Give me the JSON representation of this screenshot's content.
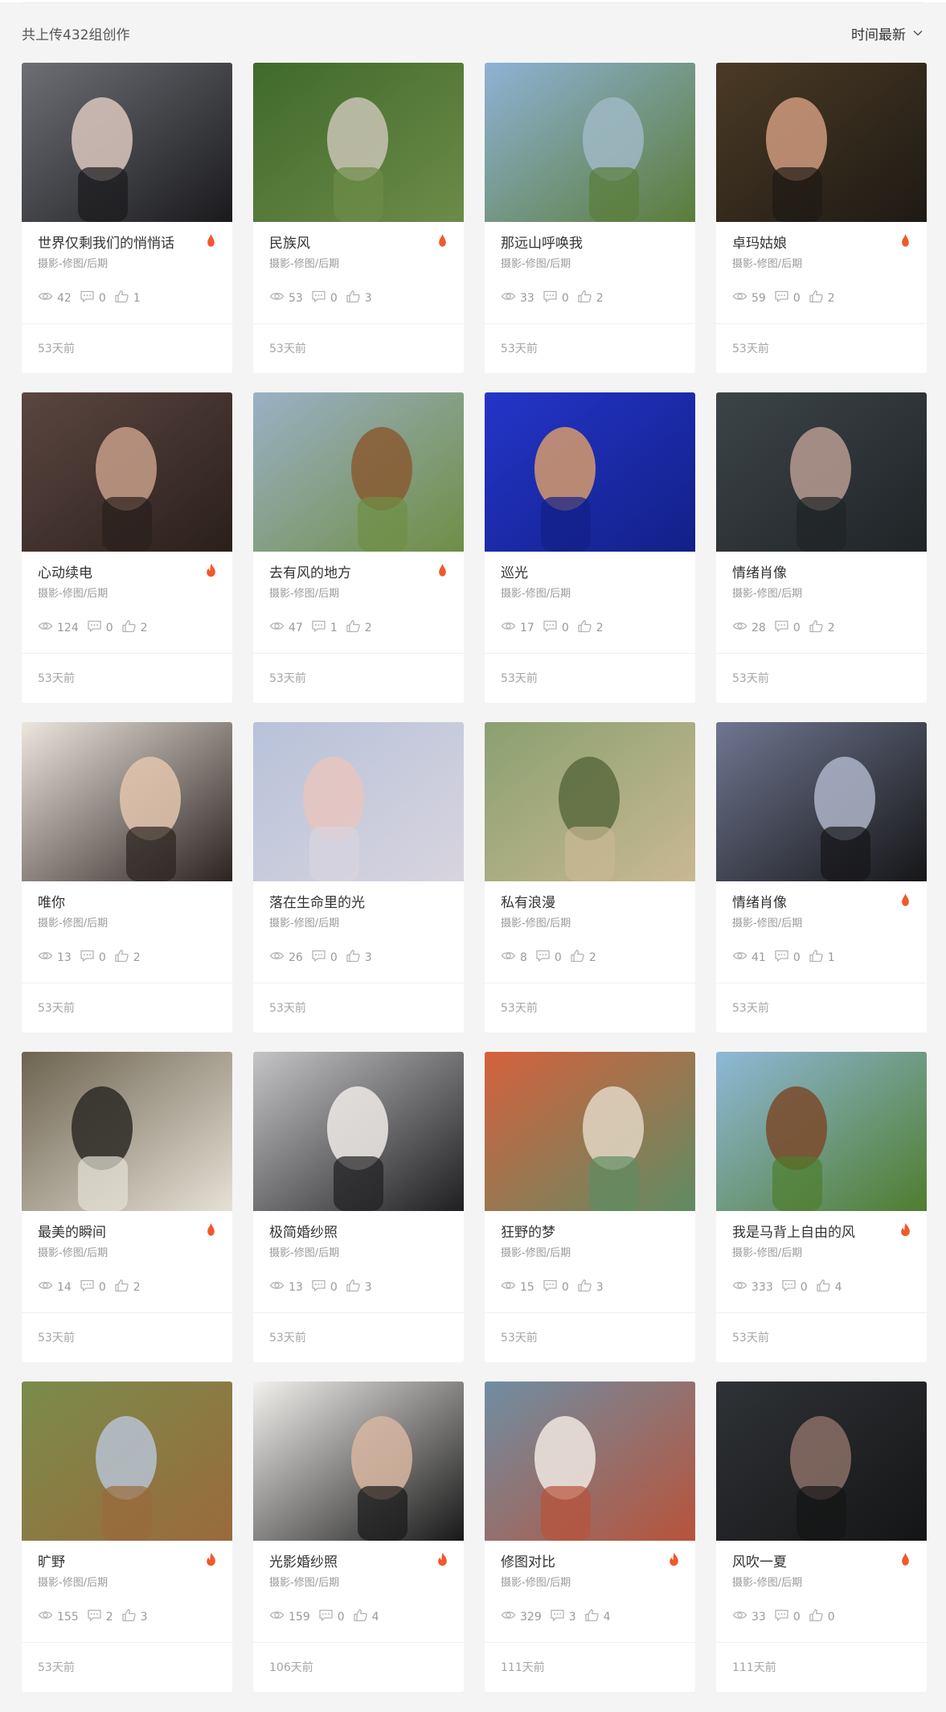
{
  "header": {
    "total_text": "共上传432组创作",
    "sort_label": "时间最新"
  },
  "colors": {
    "hot_icon": "#f1582a",
    "meta_text": "#9a9a9a",
    "title_text": "#333333"
  },
  "works": [
    {
      "title": "世界仅剩我们的悄悄话",
      "category": "摄影-修图/后期",
      "views": "42",
      "comments": "0",
      "likes": "1",
      "date": "53天前",
      "hot": "drop",
      "palette": [
        "#6d6f75",
        "#1a1a1d",
        "#d9c7bd"
      ]
    },
    {
      "title": "民族风",
      "category": "摄影-修图/后期",
      "views": "53",
      "comments": "0",
      "likes": "3",
      "date": "53天前",
      "hot": "drop",
      "palette": [
        "#3f6a2b",
        "#6d8b49",
        "#c9c3b5"
      ]
    },
    {
      "title": "那远山呼唤我",
      "category": "摄影-修图/后期",
      "views": "33",
      "comments": "0",
      "likes": "2",
      "date": "53天前",
      "hot": "none",
      "palette": [
        "#8fb2d6",
        "#5a7d3a",
        "#9fb9c4"
      ]
    },
    {
      "title": "卓玛姑娘",
      "category": "摄影-修图/后期",
      "views": "59",
      "comments": "0",
      "likes": "2",
      "date": "53天前",
      "hot": "drop",
      "palette": [
        "#4b3a25",
        "#1e1a14",
        "#cf9a7e"
      ]
    },
    {
      "title": "心动续电",
      "category": "摄影-修图/后期",
      "views": "124",
      "comments": "0",
      "likes": "2",
      "date": "53天前",
      "hot": "flame",
      "palette": [
        "#5b4640",
        "#2a1f1c",
        "#c79d88"
      ]
    },
    {
      "title": "去有风的地方",
      "category": "摄影-修图/后期",
      "views": "47",
      "comments": "1",
      "likes": "2",
      "date": "53天前",
      "hot": "drop",
      "palette": [
        "#9bb0c6",
        "#6f8e45",
        "#8a5a32"
      ]
    },
    {
      "title": "巡光",
      "category": "摄影-修图/后期",
      "views": "17",
      "comments": "0",
      "likes": "2",
      "date": "53天前",
      "hot": "none",
      "palette": [
        "#2435c9",
        "#122087",
        "#d59a6c"
      ]
    },
    {
      "title": "情绪肖像",
      "category": "摄影-修图/后期",
      "views": "28",
      "comments": "0",
      "likes": "2",
      "date": "53天前",
      "hot": "none",
      "palette": [
        "#3d4448",
        "#1f2427",
        "#b79b90"
      ]
    },
    {
      "title": "唯你",
      "category": "摄影-修图/后期",
      "views": "13",
      "comments": "0",
      "likes": "2",
      "date": "53天前",
      "hot": "none",
      "palette": [
        "#ede6df",
        "#2b2320",
        "#e3c5ae"
      ]
    },
    {
      "title": "落在生命里的光",
      "category": "摄影-修图/后期",
      "views": "26",
      "comments": "0",
      "likes": "3",
      "date": "53天前",
      "hot": "none",
      "palette": [
        "#b7c2d9",
        "#d8d4df",
        "#e8c5c0"
      ]
    },
    {
      "title": "私有浪漫",
      "category": "摄影-修图/后期",
      "views": "8",
      "comments": "0",
      "likes": "2",
      "date": "53天前",
      "hot": "none",
      "palette": [
        "#8aa070",
        "#c9b893",
        "#5b6a3e"
      ]
    },
    {
      "title": "情绪肖像",
      "category": "摄影-修图/后期",
      "views": "41",
      "comments": "0",
      "likes": "1",
      "date": "53天前",
      "hot": "drop",
      "palette": [
        "#6f7690",
        "#161618",
        "#aeb4c8"
      ]
    },
    {
      "title": "最美的瞬间",
      "category": "摄影-修图/后期",
      "views": "14",
      "comments": "0",
      "likes": "2",
      "date": "53天前",
      "hot": "drop",
      "palette": [
        "#6d6350",
        "#e6e1d6",
        "#2c2a25"
      ]
    },
    {
      "title": "极简婚纱照",
      "category": "摄影-修图/后期",
      "views": "13",
      "comments": "0",
      "likes": "3",
      "date": "53天前",
      "hot": "none",
      "palette": [
        "#c5c4c7",
        "#1f1e21",
        "#efeae6"
      ]
    },
    {
      "title": "狂野的梦",
      "category": "摄影-修图/后期",
      "views": "15",
      "comments": "0",
      "likes": "3",
      "date": "53天前",
      "hot": "none",
      "palette": [
        "#d5613d",
        "#5f8c63",
        "#e2d6c4"
      ]
    },
    {
      "title": "我是马背上自由的风",
      "category": "摄影-修图/后期",
      "views": "333",
      "comments": "0",
      "likes": "4",
      "date": "53天前",
      "hot": "flame",
      "palette": [
        "#8fb8d8",
        "#4f7d2e",
        "#7a4a2a"
      ]
    },
    {
      "title": "旷野",
      "category": "摄影-修图/后期",
      "views": "155",
      "comments": "2",
      "likes": "3",
      "date": "53天前",
      "hot": "flame",
      "palette": [
        "#7a8c4a",
        "#9a6a3c",
        "#b6c2d2"
      ]
    },
    {
      "title": "光影婚纱照",
      "category": "摄影-修图/后期",
      "views": "159",
      "comments": "0",
      "likes": "4",
      "date": "106天前",
      "hot": "flame",
      "palette": [
        "#f3f1ee",
        "#181818",
        "#d8b6a0"
      ]
    },
    {
      "title": "修图对比",
      "category": "摄影-修图/后期",
      "views": "329",
      "comments": "3",
      "likes": "4",
      "date": "111天前",
      "hot": "flame",
      "palette": [
        "#6f8ea3",
        "#b8533a",
        "#f0e8e2"
      ]
    },
    {
      "title": "风吹一夏",
      "category": "摄影-修图/后期",
      "views": "33",
      "comments": "0",
      "likes": "0",
      "date": "111天前",
      "hot": "drop",
      "palette": [
        "#2f3236",
        "#141516",
        "#8a7066"
      ]
    }
  ]
}
